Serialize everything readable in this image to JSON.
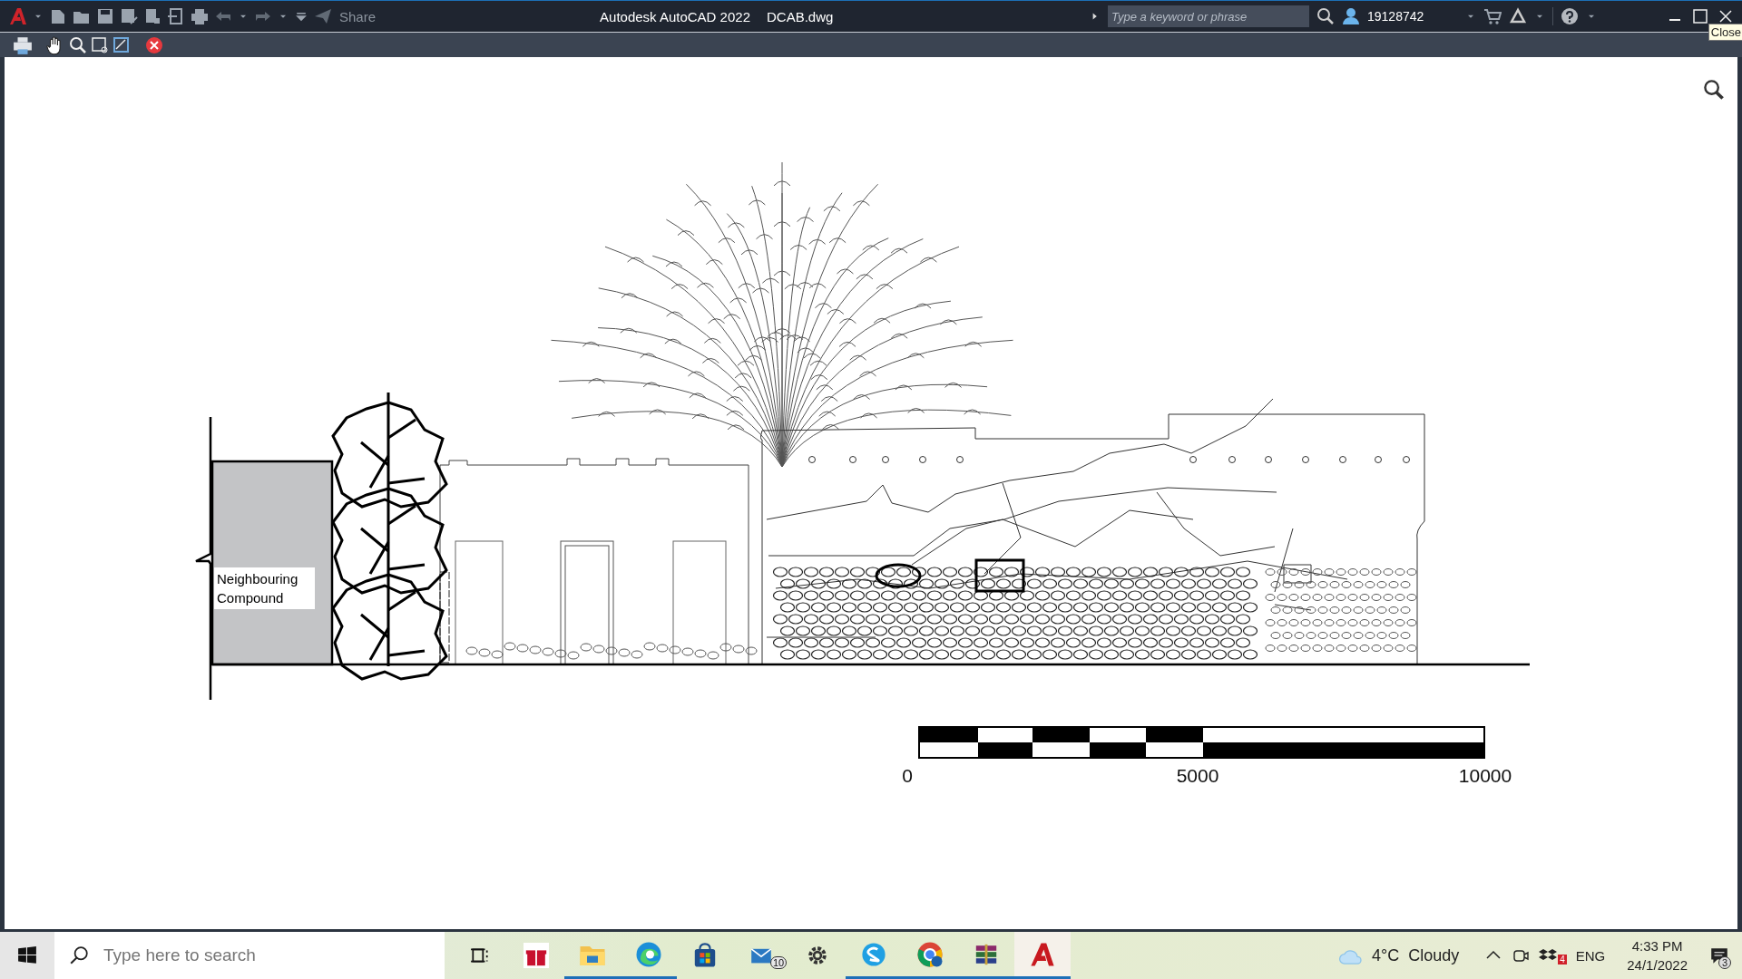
{
  "title_bar": {
    "share": "Share",
    "app_title": "Autodesk AutoCAD 2022",
    "file_name": "DCAB.dwg",
    "search": {
      "placeholder": "Type a keyword or phrase"
    },
    "user": "19128742",
    "tooltip": "Close"
  },
  "drawing": {
    "label": "Neighbouring Compound",
    "scale_labels": [
      "0",
      "5000",
      "10000"
    ]
  },
  "taskbar": {
    "search": {
      "placeholder": "Type here to search"
    },
    "apps": [
      {
        "kind": "taskview",
        "running": false,
        "selected": false
      },
      {
        "kind": "gift",
        "running": false,
        "selected": false
      },
      {
        "kind": "folder",
        "running": true,
        "selected": false
      },
      {
        "kind": "edge",
        "running": true,
        "selected": false
      },
      {
        "kind": "store",
        "running": false,
        "selected": false
      },
      {
        "kind": "mail",
        "running": false,
        "selected": false,
        "badge": "10"
      },
      {
        "kind": "gear",
        "running": false,
        "selected": false
      },
      {
        "kind": "skype",
        "running": true,
        "selected": false
      },
      {
        "kind": "chrome",
        "running": true,
        "selected": false
      },
      {
        "kind": "archive",
        "running": true,
        "selected": false
      },
      {
        "kind": "cad",
        "running": true,
        "selected": true
      }
    ],
    "weather": {
      "temp": "4°C",
      "condition": "Cloudy"
    },
    "dropbox_badge": "4",
    "language": "ENG",
    "time": "4:33 PM",
    "date": "24/1/2022",
    "notifications": "3"
  }
}
